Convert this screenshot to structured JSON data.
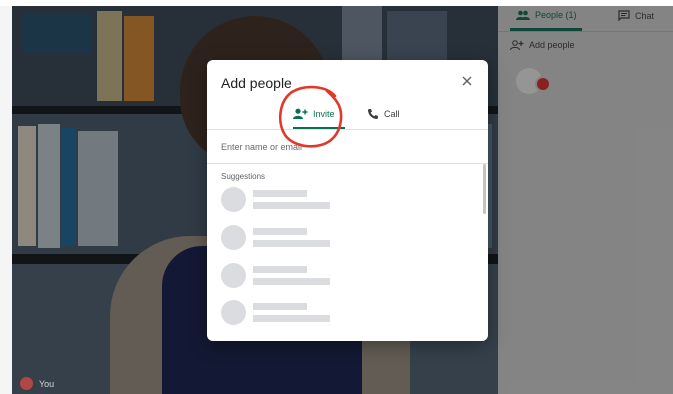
{
  "video": {
    "self_label": "You"
  },
  "side_panel": {
    "tabs": [
      {
        "label": "People (1)",
        "icon": "people-icon",
        "active": true
      },
      {
        "label": "Chat",
        "icon": "chat-icon",
        "active": false
      }
    ],
    "add_people_label": "Add people"
  },
  "dialog": {
    "title": "Add people",
    "close_icon": "close-icon",
    "tabs": [
      {
        "label": "Invite",
        "icon": "person-add-icon",
        "active": true
      },
      {
        "label": "Call",
        "icon": "phone-icon",
        "active": false
      }
    ],
    "input_placeholder": "Enter name or email",
    "suggestions_label": "Suggestions"
  },
  "colors": {
    "accent": "#0b6e4f",
    "annotation": "#e0392b",
    "mic_off": "#c5221f"
  }
}
